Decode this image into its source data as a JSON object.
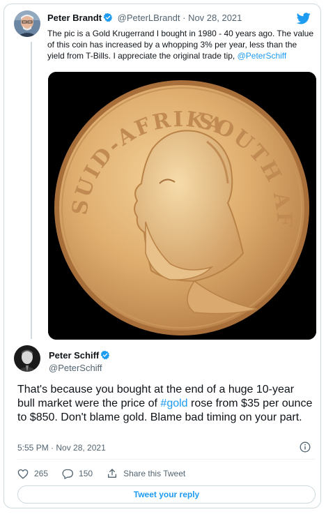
{
  "original_tweet": {
    "author_name": "Peter Brandt",
    "handle": "@PeterLBrandt",
    "separator": "·",
    "date": "Nov 28, 2021",
    "text_before_mention": "The pic is a Gold Krugerrand I bought in 1980 - 40 years ago. The value of this coin has increased by a whopping 3% per year, less than the yield from T-Bills. I appreciate the original trade tip, ",
    "mention": "@PeterSchiff",
    "image": {
      "coin_text_left": "SUID-AFRIKA",
      "coin_text_right": "SOUTH AFRICA"
    }
  },
  "reply_tweet": {
    "author_name": "Peter Schiff",
    "handle": "@PeterSchiff",
    "text_before_hashtag": "That's because you bought at the end of a huge 10-year bull market were the price of ",
    "hashtag": "#gold",
    "text_after_hashtag": " rose from $35 per ounce to $850. Don't blame gold. Blame bad timing on your part.",
    "timestamp": "5:55 PM · Nov 28, 2021"
  },
  "actions": {
    "likes": "265",
    "replies": "150",
    "share_label": "Share this Tweet"
  },
  "reply_button_label": "Tweet your reply",
  "colors": {
    "accent": "#1d9bf0",
    "like_icon_color": "#536471",
    "gold": "#d7a868"
  },
  "icons": [
    "verified-badge-icon",
    "twitter-bird-icon",
    "info-icon",
    "heart-icon",
    "comment-icon",
    "share-icon"
  ]
}
